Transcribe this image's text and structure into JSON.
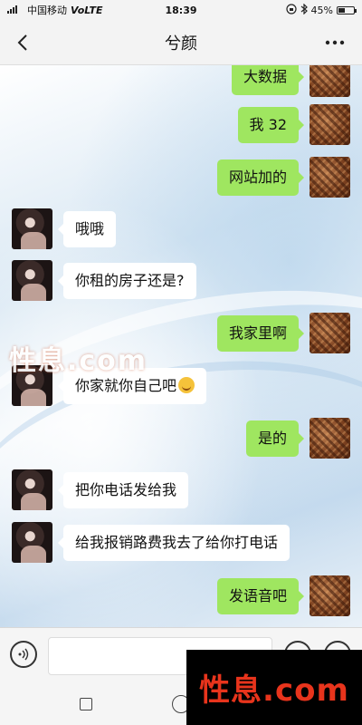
{
  "status_bar": {
    "carrier": "中国移动",
    "network": "VoLTE",
    "time": "18:39",
    "battery": "45%",
    "battery_level": 0.45
  },
  "nav": {
    "title": "兮颜",
    "back_icon": "chevron-left-icon",
    "more_icon": "more-dots-icon"
  },
  "messages": [
    {
      "from": "self",
      "text": "大数据"
    },
    {
      "from": "self",
      "text": "我 32"
    },
    {
      "from": "self",
      "text": "网站加的"
    },
    {
      "from": "other",
      "text": "哦哦"
    },
    {
      "from": "other",
      "text": "你租的房子还是?"
    },
    {
      "from": "self",
      "text": "我家里啊"
    },
    {
      "from": "other",
      "text": "你家就你自己吧"
    },
    {
      "from": "self",
      "text": "是的"
    },
    {
      "from": "other",
      "text": "把你电话发给我"
    },
    {
      "from": "other",
      "text": "给我报销路费我去了给你打电话"
    },
    {
      "from": "self",
      "text": "发语音吧"
    }
  ],
  "watermark_top": "性息.com",
  "watermark_bottom": "性息.com",
  "colors": {
    "outgoing_bubble": "#9fe660",
    "incoming_bubble": "#ffffff",
    "watermark": "#e8341c"
  }
}
